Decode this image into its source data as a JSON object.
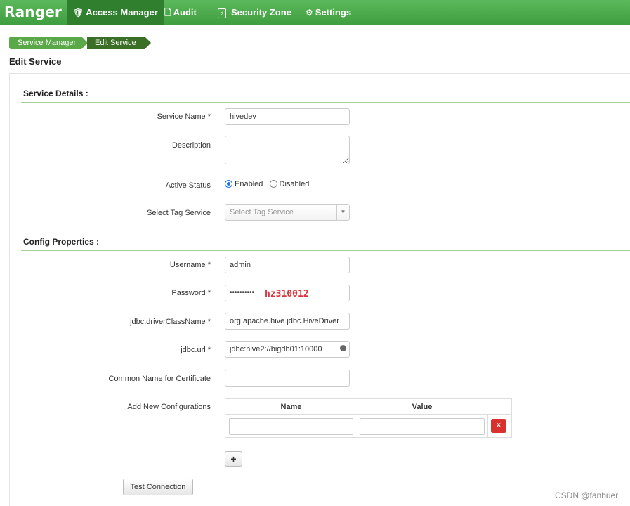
{
  "nav": {
    "brand": "Ranger",
    "items": [
      {
        "label": "Access Manager",
        "icon": "shield-icon",
        "active": true
      },
      {
        "label": "Audit",
        "icon": "file-icon",
        "active": false
      },
      {
        "label": "Security Zone",
        "icon": "zone-icon",
        "active": false
      },
      {
        "label": "Settings",
        "icon": "gear-icon",
        "active": false
      }
    ]
  },
  "breadcrumb": [
    "Service Manager",
    "Edit Service"
  ],
  "page_title": "Edit Service",
  "service_details": {
    "title": "Service Details :",
    "service_name_label": "Service Name *",
    "service_name_value": "hivedev",
    "description_label": "Description",
    "active_status_label": "Active Status",
    "enabled_label": "Enabled",
    "disabled_label": "Disabled",
    "active_status_value": "Enabled",
    "tag_service_label": "Select Tag Service",
    "tag_service_placeholder": "Select Tag Service"
  },
  "config": {
    "title": "Config Properties :",
    "username_label": "Username *",
    "username_value": "admin",
    "password_label": "Password *",
    "password_dots": "••••••••••",
    "password_annotation": "hz310012",
    "driver_label": "jdbc.driverClassName *",
    "driver_value": "org.apache.hive.jdbc.HiveDriver",
    "url_label": "jdbc.url *",
    "url_value": "jdbc:hive2://bigdb01:10000",
    "cert_label": "Common Name for Certificate",
    "add_config_label": "Add New Configurations",
    "table_name_header": "Name",
    "table_value_header": "Value",
    "delete_label": "×",
    "add_label": "+"
  },
  "test_connection_label": "Test Connection",
  "watermark": "CSDN @fanbuer",
  "colors": {
    "nav_green": "#4aa84a",
    "accent_red": "#d9312d"
  }
}
